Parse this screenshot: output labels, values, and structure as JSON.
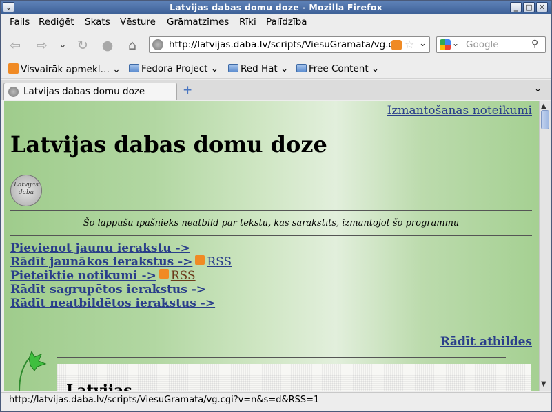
{
  "window": {
    "title": "Latvijas dabas domu doze - Mozilla Firefox",
    "btn_menu": "⌄",
    "btn_minimize": "_",
    "btn_maximize": "□",
    "btn_close": "✕"
  },
  "menubar": {
    "items": [
      "Fails",
      "Rediģēt",
      "Skats",
      "Vēsture",
      "Grāmatzīmes",
      "Rīki",
      "Palīdzība"
    ]
  },
  "navbar": {
    "url": "http://latvijas.daba.lv/scripts/ViesuGramata/vg.c",
    "search_placeholder": "Google"
  },
  "bookmarks": {
    "items": [
      "Visvairāk apmekl…",
      "Fedora Project",
      "Red Hat",
      "Free Content"
    ]
  },
  "tabs": {
    "items": [
      {
        "label": "Latvijas dabas domu doze"
      }
    ],
    "new_tab": "+",
    "list": "⌄"
  },
  "page": {
    "terms_link": "Izmantošanas noteikumi",
    "title": "Latvijas dabas domu doze",
    "logo_text": "Latvijas daba",
    "disclaimer": "Šo lappušu īpašnieks neatbild par tekstu, kas sarakstīts, izmantojot šo programmu",
    "nav": [
      {
        "label": "Pievienot jaunu ierakstu ->"
      },
      {
        "label": "Rādīt jaunākos ierakstus ->",
        "rss": "RSS"
      },
      {
        "label": "Pieteiktie notikumi ->",
        "rss": "RSS"
      },
      {
        "label": "Rādīt sagrupētos ierakstus ->"
      },
      {
        "label": "Rādīt neatbildētos ierakstus ->"
      }
    ],
    "show_replies": "Rādīt atbildes",
    "entry_heading": "Latvijas"
  },
  "statusbar": {
    "text": "http://latvijas.daba.lv/scripts/ViesuGramata/vg.cgi?v=n&s=d&RSS=1"
  },
  "colors": {
    "link": "#2a3e8a",
    "visited": "#6b3a1a",
    "rss": "#f08a24",
    "titlebar": "#4a6fa5"
  }
}
